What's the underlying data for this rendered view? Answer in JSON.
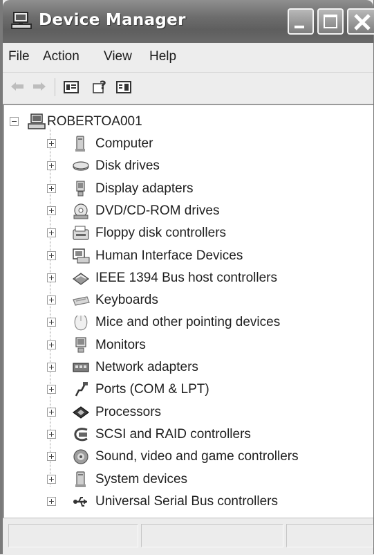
{
  "window": {
    "title": "Device Manager",
    "title_icon": "computer-monitor-icon"
  },
  "menu": [
    "File",
    "Action",
    "View",
    "Help"
  ],
  "toolbar": {
    "buttons": [
      "back-icon",
      "forward-icon",
      "properties-icon",
      "help-icon",
      "show-hide-tree-icon"
    ]
  },
  "tree": {
    "root": {
      "label": "ROBERTOA001",
      "icon": "computer-icon",
      "expanded": true
    },
    "children": [
      {
        "label": "Computer",
        "icon": "computer-icon"
      },
      {
        "label": "Disk drives",
        "icon": "disk-drive-icon"
      },
      {
        "label": "Display adapters",
        "icon": "display-adapter-icon"
      },
      {
        "label": "DVD/CD-ROM drives",
        "icon": "cd-rom-icon"
      },
      {
        "label": "Floppy disk controllers",
        "icon": "floppy-controller-icon"
      },
      {
        "label": "Human Interface Devices",
        "icon": "hid-icon"
      },
      {
        "label": "IEEE 1394 Bus host controllers",
        "icon": "ieee1394-icon"
      },
      {
        "label": "Keyboards",
        "icon": "keyboard-icon"
      },
      {
        "label": "Mice and other pointing devices",
        "icon": "mouse-icon"
      },
      {
        "label": "Monitors",
        "icon": "monitor-icon"
      },
      {
        "label": "Network adapters",
        "icon": "network-adapter-icon"
      },
      {
        "label": "Ports (COM & LPT)",
        "icon": "port-icon"
      },
      {
        "label": "Processors",
        "icon": "processor-icon"
      },
      {
        "label": "SCSI and RAID controllers",
        "icon": "scsi-icon"
      },
      {
        "label": "Sound, video and game controllers",
        "icon": "sound-icon"
      },
      {
        "label": "System devices",
        "icon": "system-device-icon"
      },
      {
        "label": "Universal Serial Bus controllers",
        "icon": "usb-icon"
      }
    ]
  },
  "statusbar": {
    "cells": [
      "",
      "",
      ""
    ]
  }
}
